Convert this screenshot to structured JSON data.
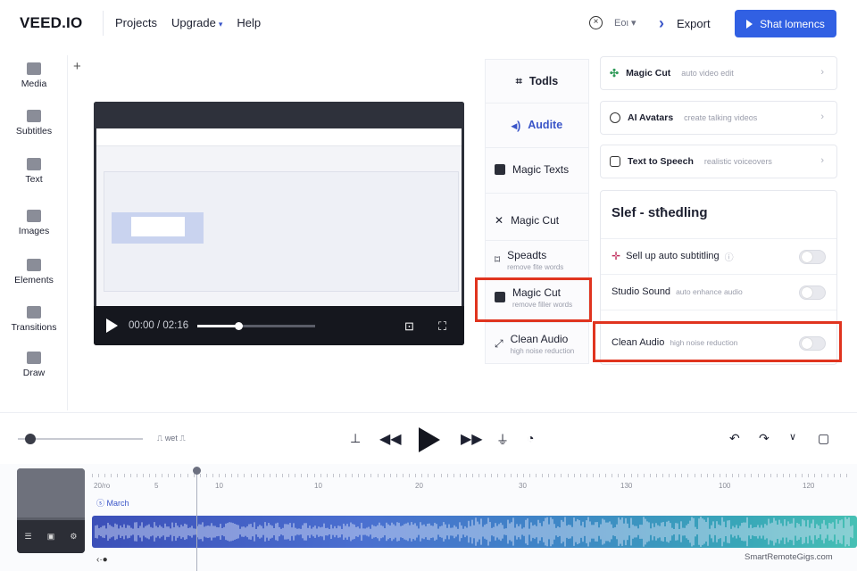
{
  "header": {
    "logo": "VEED.IO",
    "nav": [
      "Projects",
      "Upgrade",
      "Help"
    ],
    "edit_label": "Eoι",
    "export_label": "Export",
    "start_button": "Sħat lomencs"
  },
  "sidebar": {
    "items": [
      {
        "label": "Media",
        "icon": "media-icon"
      },
      {
        "label": "Subtitles",
        "icon": "subtitles-icon"
      },
      {
        "label": "Text",
        "icon": "text-icon"
      },
      {
        "label": "Images",
        "icon": "images-icon"
      },
      {
        "label": "Elements",
        "icon": "elements-icon"
      },
      {
        "label": "Transitions",
        "icon": "transitions-icon"
      },
      {
        "label": "Draw",
        "icon": "draw-icon"
      }
    ]
  },
  "player": {
    "time": "00:00 / 02:16",
    "progress": 0.35
  },
  "tools": {
    "header": "Todls",
    "items": [
      {
        "label": "Audite",
        "sub": ""
      },
      {
        "label": "Magic Texts",
        "sub": ""
      },
      {
        "label": "Magic Cut",
        "sub": ""
      },
      {
        "label": "Speadts",
        "sub": "remove fite words"
      },
      {
        "label": "Magic Cut",
        "sub": "remove filler words"
      },
      {
        "label": "Clean Audio",
        "sub": "high noise reduction"
      }
    ]
  },
  "features": [
    {
      "title": "Magic Cut",
      "desc": "auto video edit"
    },
    {
      "title": "AI Avatars",
      "desc": "create talking videos"
    },
    {
      "title": "Text to Speech",
      "desc": "realistic voiceovers"
    }
  ],
  "subtitling": {
    "title": "Slef - stħedling",
    "rows": [
      {
        "label": "Sell up auto subtitling",
        "desc": ""
      },
      {
        "label": "Studio Sound",
        "desc": "auto enhance audio"
      },
      {
        "label": "Clean Audio",
        "desc": "high noise reduction"
      }
    ]
  },
  "transport": {
    "split_label": "wet"
  },
  "timeline": {
    "ticks": [
      "20/ro",
      "5",
      "10",
      "10",
      "20",
      "30",
      "130",
      "100",
      "120"
    ],
    "marker": "March"
  },
  "watermark": "SmartRemoteGigs.com",
  "colors": {
    "accent": "#3160e3",
    "highlight": "#e0341f"
  }
}
